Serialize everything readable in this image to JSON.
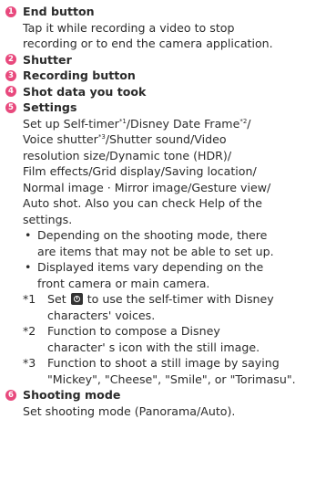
{
  "items": [
    {
      "number": "1",
      "title": "End button",
      "desc_lines": [
        "Tap it while recording a video to stop",
        "recording or to end the camera application."
      ]
    },
    {
      "number": "2",
      "title": "Shutter"
    },
    {
      "number": "3",
      "title": "Recording button"
    },
    {
      "number": "4",
      "title": "Shot data you took"
    },
    {
      "number": "5",
      "title": "Settings",
      "desc": {
        "l1_a": "Set up Self-timer",
        "l1_s1": "*1",
        "l1_b": "/Disney Date Frame",
        "l1_s2": "*2",
        "l1_c": "/",
        "l2_a": "Voice shutter",
        "l2_s3": "*3",
        "l2_b": "/Shutter sound/Video",
        "l3": "resolution size/Dynamic tone (HDR)/",
        "l4": "Film effects/Grid display/Saving location/",
        "l5": "Normal image · Mirror image/Gesture view/",
        "l6": "Auto shot. Also you can check Help of the",
        "l7": "settings."
      },
      "bullets": [
        {
          "mark": "•",
          "lines": [
            "Depending on the shooting mode, there",
            "are items that may not be able to set up."
          ]
        },
        {
          "mark": "•",
          "lines": [
            "Displayed items vary depending on the",
            "front camera or main camera."
          ]
        }
      ],
      "notes": [
        {
          "mark": "*1",
          "line1_a": "Set",
          "line1_b": "to use the self-timer with Disney",
          "line2": "characters' voices."
        },
        {
          "mark": "*2",
          "line1": "Function to compose a Disney",
          "line2": "character' s icon with the still image."
        },
        {
          "mark": "*3",
          "line1": "Function to shoot a still image by saying",
          "line2": "\"Mickey\", \"Cheese\", \"Smile\", or \"Torimasu\"."
        }
      ]
    },
    {
      "number": "6",
      "title": "Shooting mode",
      "desc_lines": [
        "Set shooting mode (Panorama/Auto)."
      ]
    }
  ],
  "icons": {
    "number_badge": "circle-number-badge",
    "self_timer": "self-timer-icon"
  },
  "colors": {
    "badge": "#e8497d",
    "text": "#2b2b2b"
  }
}
